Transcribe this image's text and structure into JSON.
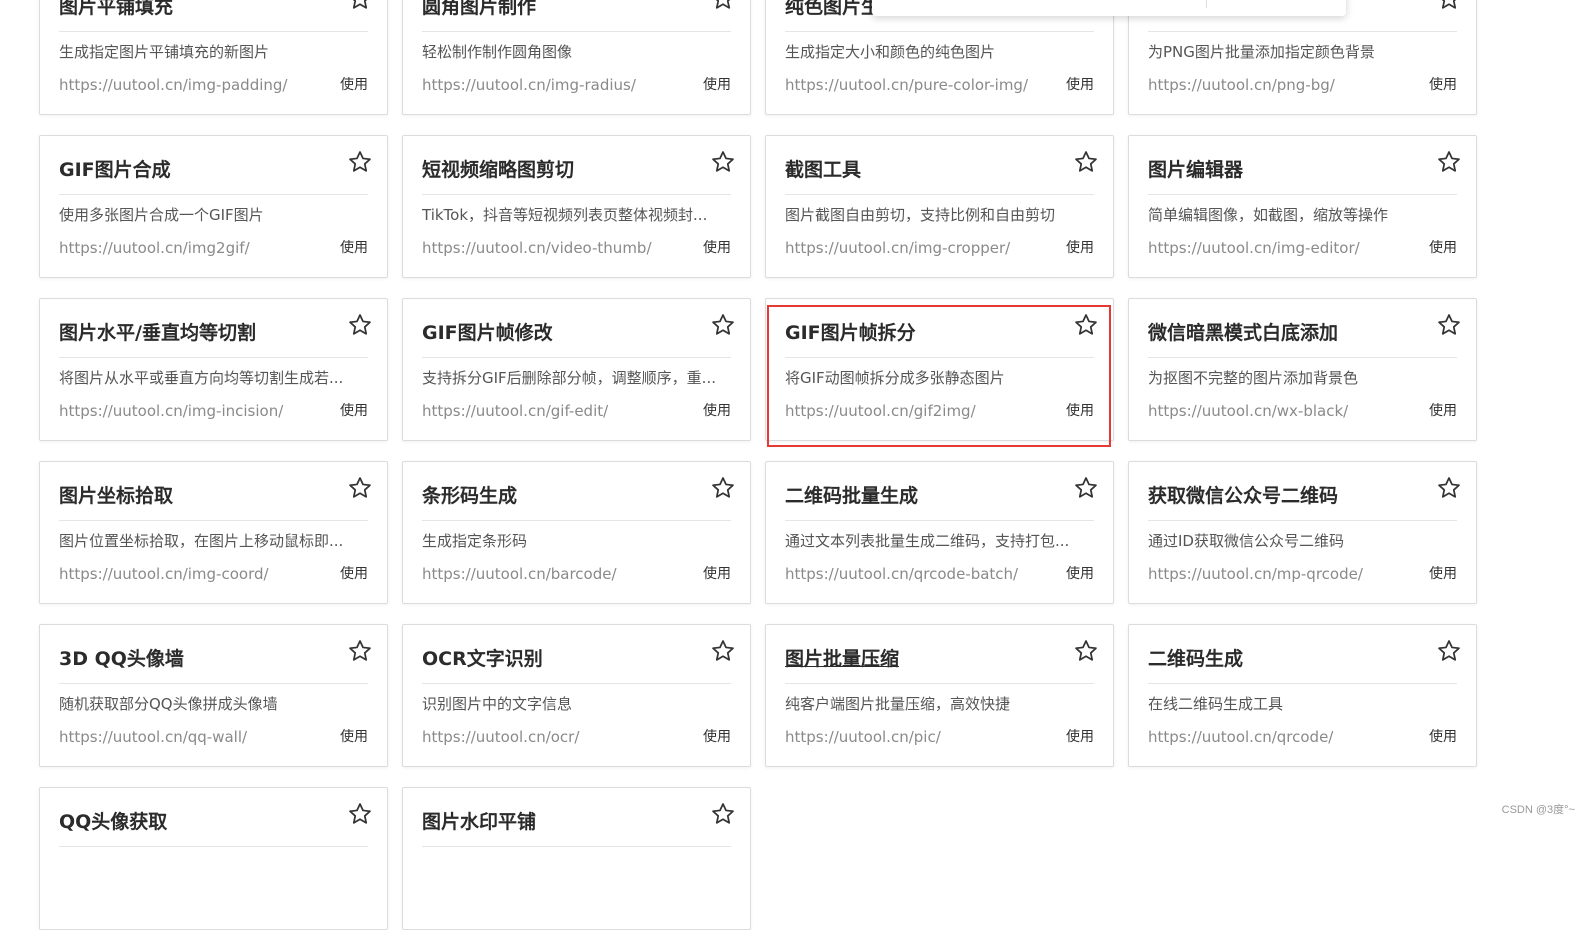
{
  "cards": [
    {
      "title": "图片平铺填充",
      "desc": "生成指定图片平铺填充的新图片",
      "url": "https://uutool.cn/img-padding/",
      "use": "使用"
    },
    {
      "title": "圆角图片制作",
      "desc": "轻松制作制作圆角图像",
      "url": "https://uutool.cn/img-radius/",
      "use": "使用"
    },
    {
      "title": "纯色图片生",
      "desc": "生成指定大小和颜色的纯色图片",
      "url": "https://uutool.cn/pure-color-img/",
      "use": "使用"
    },
    {
      "title": "",
      "desc": "为PNG图片批量添加指定颜色背景",
      "url": "https://uutool.cn/png-bg/",
      "use": "使用"
    },
    {
      "title": "GIF图片合成",
      "desc": "使用多张图片合成一个GIF图片",
      "url": "https://uutool.cn/img2gif/",
      "use": "使用"
    },
    {
      "title": "短视频缩略图剪切",
      "desc": "TikTok，抖音等短视频列表页整体视频封...",
      "url": "https://uutool.cn/video-thumb/",
      "use": "使用"
    },
    {
      "title": "截图工具",
      "desc": "图片截图自由剪切，支持比例和自由剪切",
      "url": "https://uutool.cn/img-cropper/",
      "use": "使用"
    },
    {
      "title": "图片编辑器",
      "desc": "简单编辑图像，如截图，缩放等操作",
      "url": "https://uutool.cn/img-editor/",
      "use": "使用"
    },
    {
      "title": "图片水平/垂直均等切割",
      "desc": "将图片从水平或垂直方向均等切割生成若...",
      "url": "https://uutool.cn/img-incision/",
      "use": "使用"
    },
    {
      "title": "GIF图片帧修改",
      "desc": "支持拆分GIF后删除部分帧，调整顺序，重...",
      "url": "https://uutool.cn/gif-edit/",
      "use": "使用"
    },
    {
      "title": "GIF图片帧拆分",
      "desc": "将GIF动图帧拆分成多张静态图片",
      "url": "https://uutool.cn/gif2img/",
      "use": "使用"
    },
    {
      "title": "微信暗黑模式白底添加",
      "desc": "为抠图不完整的图片添加背景色",
      "url": "https://uutool.cn/wx-black/",
      "use": "使用"
    },
    {
      "title": "图片坐标拾取",
      "desc": "图片位置坐标拾取，在图片上移动鼠标即...",
      "url": "https://uutool.cn/img-coord/",
      "use": "使用"
    },
    {
      "title": "条形码生成",
      "desc": "生成指定条形码",
      "url": "https://uutool.cn/barcode/",
      "use": "使用"
    },
    {
      "title": "二维码批量生成",
      "desc": "通过文本列表批量生成二维码，支持打包...",
      "url": "https://uutool.cn/qrcode-batch/",
      "use": "使用"
    },
    {
      "title": "获取微信公众号二维码",
      "desc": "通过ID获取微信公众号二维码",
      "url": "https://uutool.cn/mp-qrcode/",
      "use": "使用"
    },
    {
      "title": "3D QQ头像墙",
      "desc": "随机获取部分QQ头像拼成头像墙",
      "url": "https://uutool.cn/qq-wall/",
      "use": "使用"
    },
    {
      "title": "OCR文字识别",
      "desc": "识别图片中的文字信息",
      "url": "https://uutool.cn/ocr/",
      "use": "使用"
    },
    {
      "title": "图片批量压缩",
      "desc": "纯客户端图片批量压缩，高效快捷",
      "url": "https://uutool.cn/pic/",
      "use": "使用",
      "hovered": true
    },
    {
      "title": "二维码生成",
      "desc": "在线二维码生成工具",
      "url": "https://uutool.cn/qrcode/",
      "use": "使用"
    },
    {
      "title": "QQ头像获取",
      "desc": "",
      "url": "",
      "use": ""
    },
    {
      "title": "图片水印平铺",
      "desc": "",
      "url": "",
      "use": ""
    }
  ],
  "highlight_color": "#e53935",
  "watermark": "CSDN @3度°~"
}
